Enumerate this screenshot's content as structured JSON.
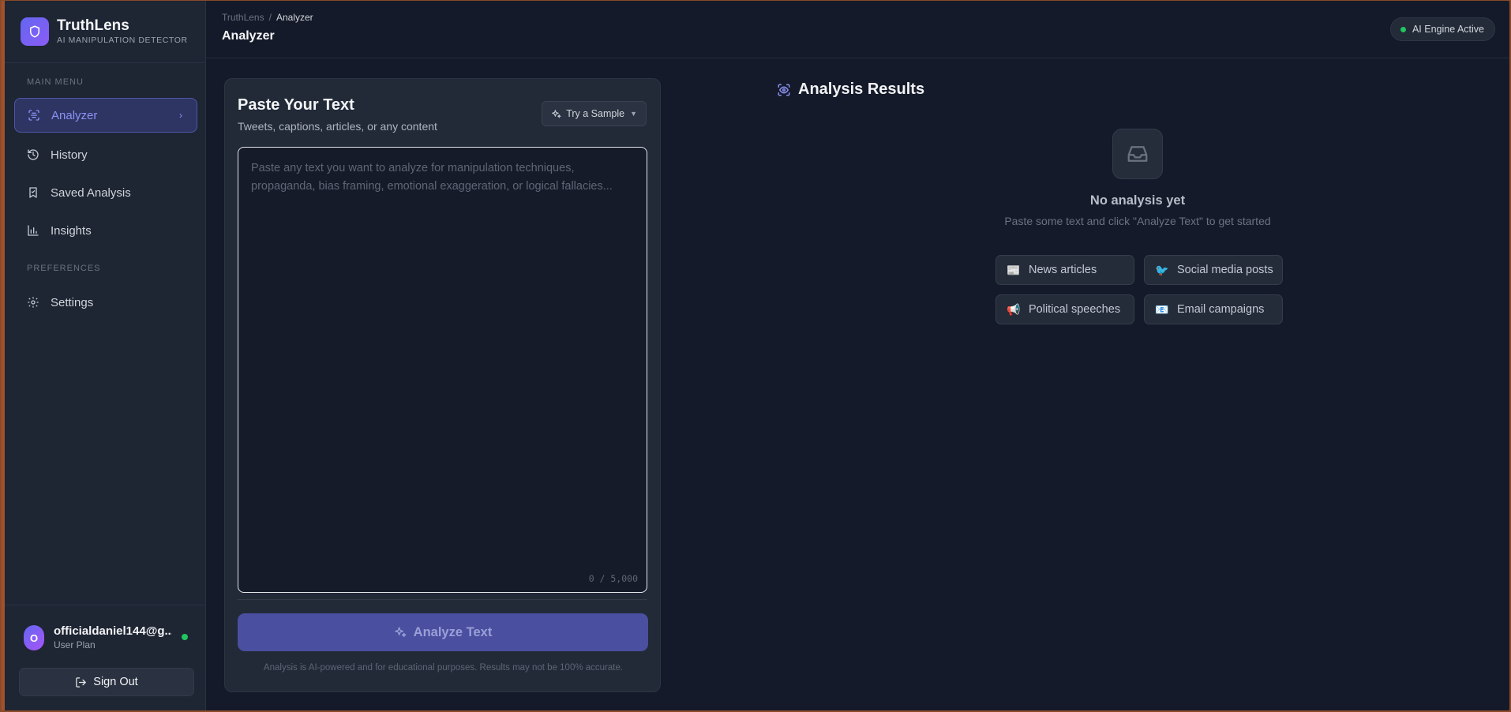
{
  "brand": {
    "name": "TruthLens",
    "tagline": "AI MANIPULATION DETECTOR"
  },
  "sidebar": {
    "main_menu_label": "MAIN MENU",
    "preferences_label": "PREFERENCES",
    "items": [
      {
        "label": "Analyzer",
        "icon": "scan-icon",
        "active": true
      },
      {
        "label": "History",
        "icon": "history-icon"
      },
      {
        "label": "Saved Analysis",
        "icon": "bookmark-icon"
      },
      {
        "label": "Insights",
        "icon": "bar-chart-icon"
      }
    ],
    "pref_items": [
      {
        "label": "Settings",
        "icon": "gear-icon"
      }
    ]
  },
  "user": {
    "initial": "O",
    "email": "officialdaniel144@g...",
    "plan": "User Plan",
    "sign_out": "Sign Out"
  },
  "topbar": {
    "breadcrumb_root": "TruthLens",
    "breadcrumb_sep": "/",
    "breadcrumb_current": "Analyzer",
    "title": "Analyzer",
    "status": "AI Engine Active"
  },
  "input_card": {
    "title": "Paste Your Text",
    "subtitle": "Tweets, captions, articles, or any content",
    "sample_button": "Try a Sample",
    "placeholder": "Paste any text you want to analyze for manipulation techniques, propaganda, bias framing, emotional exaggeration, or logical fallacies...",
    "char_count": "0 / 5,000",
    "analyze_button": "Analyze Text",
    "disclaimer": "Analysis is AI-powered and for educational purposes. Results may not be 100% accurate."
  },
  "results": {
    "title": "Analysis Results",
    "empty_title": "No analysis yet",
    "empty_subtitle": "Paste some text and click \"Analyze Text\" to get started",
    "chips": [
      {
        "emoji": "📰",
        "label": "News articles"
      },
      {
        "emoji": "🐦",
        "label": "Social media posts"
      },
      {
        "emoji": "📢",
        "label": "Political speeches"
      },
      {
        "emoji": "📧",
        "label": "Email campaigns"
      }
    ]
  },
  "colors": {
    "accent": "#6366f1",
    "active_text": "#8b93f5",
    "status_green": "#22c55e",
    "background": "#141a29"
  }
}
